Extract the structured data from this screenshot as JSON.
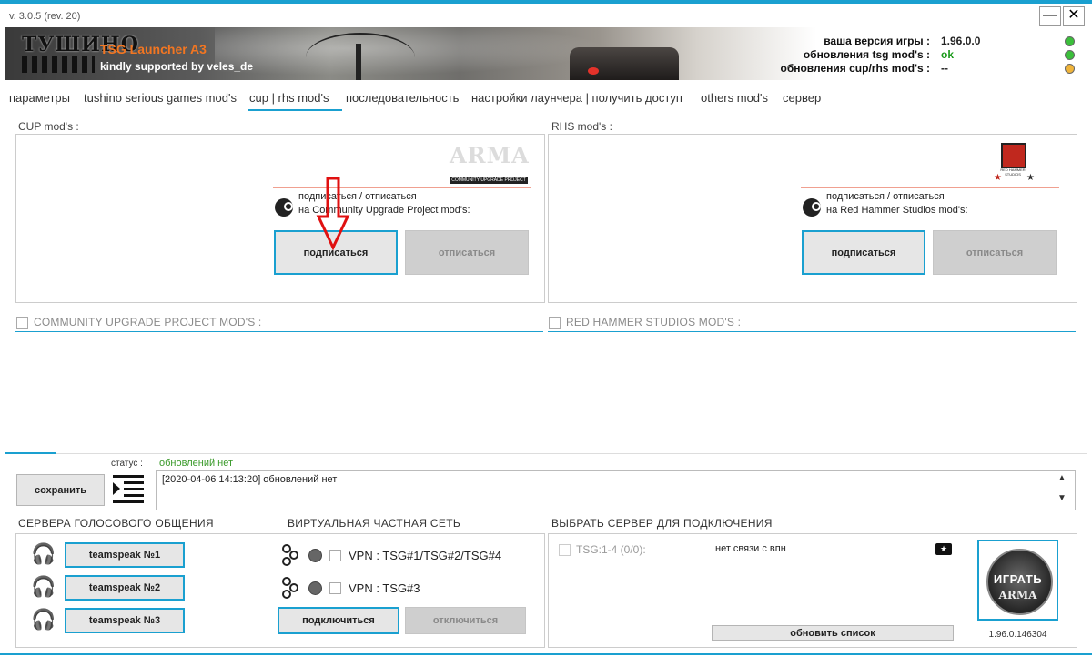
{
  "window": {
    "version": "v. 3.0.5 (rev. 20)",
    "minimize_glyph": "—",
    "close_glyph": "✕"
  },
  "banner": {
    "logo_text": "ТУШИНО",
    "title": "TSG Launcher A3",
    "subtitle": "kindly supported by veles_de",
    "info": [
      {
        "label": "ваша версия игры :",
        "value": "1.96.0.0",
        "value_color": "#111111",
        "status_color": "#3bbf3b"
      },
      {
        "label": "обновления tsg mod's :",
        "value": "ok",
        "value_color": "#1a9a1a",
        "status_color": "#3bbf3b"
      },
      {
        "label": "обновления cup/rhs mod's :",
        "value": "--",
        "value_color": "#111111",
        "status_color": "#f0b43a"
      }
    ]
  },
  "tabs": [
    "параметры",
    "tushino serious games mod's",
    "cup | rhs mod's",
    "последовательность",
    "настройки лаунчера | получить доступ",
    "others mod's",
    "сервер"
  ],
  "active_tab_index": 2,
  "cup": {
    "title": "CUP mod's :",
    "logo_main": "ARMA",
    "logo_caption": "COMMUNITY UPGRADE PROJECT",
    "line1": "подписаться / отписаться",
    "line2": "на Community Upgrade Project mod's:",
    "subscribe": "подписаться",
    "unsubscribe": "отписаться",
    "section_label": "COMMUNITY UPGRADE PROJECT MOD'S :"
  },
  "rhs": {
    "title": "RHS mod's :",
    "logo_caption": "RED HAMMER STUDIOS",
    "line1": "подписаться / отписаться",
    "line2": "на Red Hammer Studios mod's:",
    "subscribe": "подписаться",
    "unsubscribe": "отписаться",
    "section_label": "RED HAMMER STUDIOS MOD'S :"
  },
  "status": {
    "label": "статус :",
    "value": "обновлений нет",
    "log": "[2020-04-06 14:13:20] обновлений нет",
    "save": "сохранить"
  },
  "voice": {
    "title": "СЕРВЕРА ГОЛОСОВОГО ОБЩЕНИЯ",
    "buttons": [
      "teamspeak №1",
      "teamspeak №2",
      "teamspeak №3"
    ]
  },
  "vpn": {
    "title": "ВИРТУАЛЬНАЯ ЧАСТНАЯ СЕТЬ",
    "items": [
      "VPN : TSG#1/TSG#2/TSG#4",
      "VPN : TSG#3"
    ],
    "connect": "подключиться",
    "disconnect": "отключиться"
  },
  "server": {
    "title": "ВЫБРАТЬ СЕРВЕР ДЛЯ ПОДКЛЮЧЕНИЯ",
    "entry": "TSG:1-4 (0/0):",
    "status": "нет связи с впн",
    "refresh": "обновить список",
    "play_label": "ИГРАТЬ",
    "play_logo": "ARMA",
    "version": "1.96.0.146304"
  }
}
